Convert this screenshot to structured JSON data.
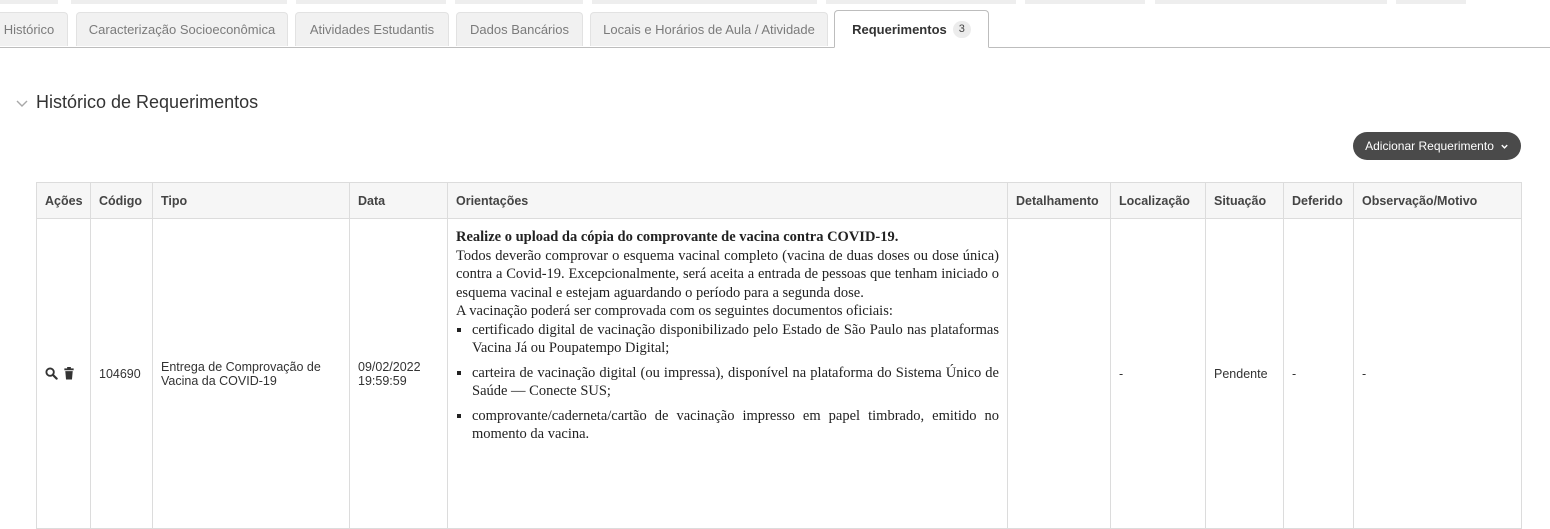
{
  "tabs": [
    {
      "label": "Histórico"
    },
    {
      "label": "Caracterização Socioeconômica"
    },
    {
      "label": "Atividades Estudantis"
    },
    {
      "label": "Dados Bancários"
    },
    {
      "label": "Locais e Horários de Aula / Atividade"
    },
    {
      "label": "Requerimentos",
      "badge": "3",
      "active": true
    }
  ],
  "section": {
    "title": "Histórico de Requerimentos",
    "icon": "chevron-down-icon"
  },
  "add_button": {
    "label": "Adicionar Requerimento",
    "icon": "chevron-down-icon"
  },
  "table": {
    "headers": [
      "Ações",
      "Código",
      "Tipo",
      "Data",
      "Orientações",
      "Detalhamento",
      "Localização",
      "Situação",
      "Deferido",
      "Observação/Motivo"
    ],
    "rows": [
      {
        "actions": [
          "search-icon",
          "trash-icon"
        ],
        "codigo": "104690",
        "tipo": "Entrega de Comprovação de Vacina da COVID-19",
        "data": "09/02/2022 19:59:59",
        "orientacoes": {
          "title": "Realize o upload da cópia do comprovante de vacina contra COVID-19.",
          "paragraph1": "Todos deverão comprovar o esquema vacinal completo (vacina de duas doses ou dose única) contra a Covid-19. Excepcionalmente, será aceita a entrada de pessoas que tenham iniciado o esquema vacinal e estejam aguardando o período para a segunda dose.",
          "paragraph2": "A vacinação poderá ser comprovada com os seguintes documentos oficiais:",
          "items": [
            "certificado digital de vacinação disponibilizado pelo Estado de São Paulo nas plataformas Vacina Já ou Poupatempo Digital;",
            "carteira de vacinação digital (ou impressa), disponível na plataforma do Sistema Único de Saúde — Conecte SUS;",
            "comprovante/caderneta/cartão de vacinação impresso em papel timbrado, emitido no momento da vacina."
          ]
        },
        "detalhamento": "",
        "localizacao": "-",
        "situacao": "Pendente",
        "deferido": "-",
        "observacao": "-"
      }
    ]
  }
}
